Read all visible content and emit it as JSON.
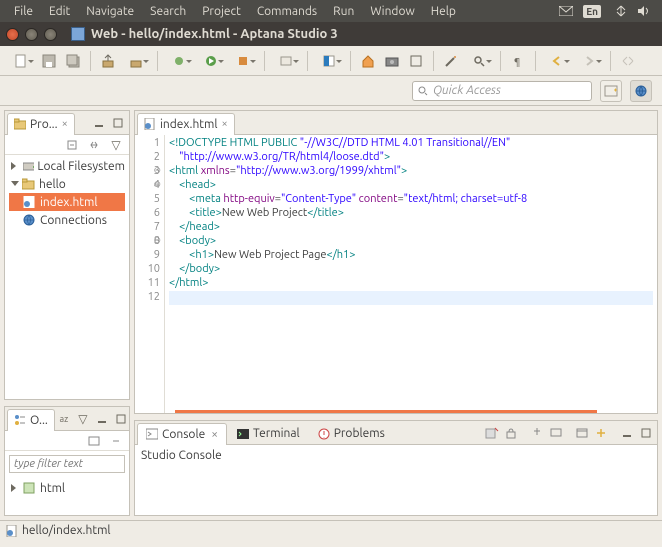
{
  "os_menu": [
    "File",
    "Edit",
    "Navigate",
    "Search",
    "Project",
    "Commands",
    "Run",
    "Window",
    "Help"
  ],
  "os_indicators": {
    "lang": "En"
  },
  "window_title": "Web - hello/index.html - Aptana Studio 3",
  "quick_access_placeholder": "Quick Access",
  "project_explorer": {
    "tab_label": "Pro...",
    "items": {
      "local_fs": "Local Filesystem",
      "project": "hello",
      "file": "index.html",
      "connections": "Connections"
    }
  },
  "editor": {
    "tab_label": "index.html",
    "lines": [
      {
        "n": "1",
        "html": "<span class='tag'>&lt;!DOCTYPE</span> <span class='doctype'>HTML PUBLIC</span> <span class='str'>\"-//W3C//DTD HTML 4.01 Transitional//EN\"</span>"
      },
      {
        "n": "2",
        "html": "    <span class='str'>\"http://www.w3.org/TR/html4/loose.dtd\"</span><span class='tag'>&gt;</span>"
      },
      {
        "n": "3",
        "fold": true,
        "html": "<span class='tag'>&lt;html</span> <span class='attr'>xmlns</span>=<span class='str'>\"http://www.w3.org/1999/xhtml\"</span><span class='tag'>&gt;</span>"
      },
      {
        "n": "4",
        "fold": true,
        "html": "    <span class='tag'>&lt;head&gt;</span>"
      },
      {
        "n": "5",
        "html": "        <span class='tag'>&lt;meta</span> <span class='attr'>http-equiv</span>=<span class='str'>\"Content-Type\"</span> <span class='attr'>content</span>=<span class='str'>\"text/html; charset=utf-8</span>"
      },
      {
        "n": "6",
        "html": "        <span class='tag'>&lt;title&gt;</span>New Web Project<span class='tag'>&lt;/title&gt;</span>"
      },
      {
        "n": "7",
        "html": "    <span class='tag'>&lt;/head&gt;</span>"
      },
      {
        "n": "8",
        "fold": true,
        "html": "    <span class='tag'>&lt;body&gt;</span>"
      },
      {
        "n": "9",
        "html": "        <span class='tag'>&lt;h1&gt;</span>New Web Project Page<span class='tag'>&lt;/h1&gt;</span>"
      },
      {
        "n": "10",
        "html": "    <span class='tag'>&lt;/body&gt;</span>"
      },
      {
        "n": "11",
        "html": "<span class='tag'>&lt;/html&gt;</span>"
      },
      {
        "n": "12",
        "hl": true,
        "html": ""
      }
    ]
  },
  "outline": {
    "tab_label": "O...",
    "filter_placeholder": "type filter text",
    "root": "html"
  },
  "bottom_tabs": {
    "console": "Console",
    "terminal": "Terminal",
    "problems": "Problems",
    "console_text": "Studio Console"
  },
  "statusbar": {
    "path": "hello/index.html"
  }
}
